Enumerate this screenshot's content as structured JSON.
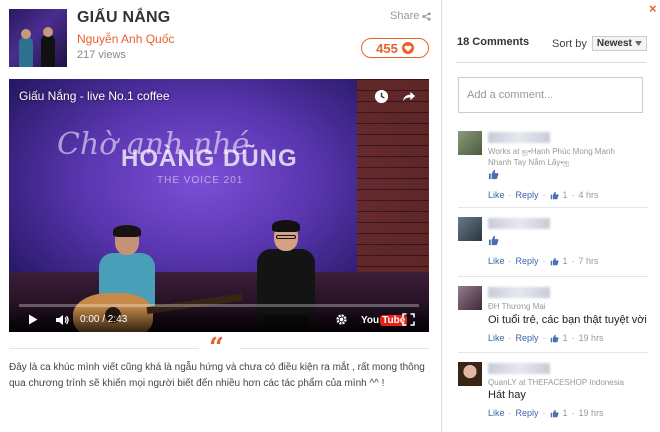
{
  "header": {
    "song_title": "GIẤU NẮNG",
    "artist": "Nguyễn Anh Quốc",
    "views": "217 views",
    "share_label": "Share",
    "like_count": "455"
  },
  "video": {
    "title": "Giấu Nắng - live No.1 coffee",
    "stage_line1": "Chờ anh nhé",
    "stage_line2": "HOÀNG DŨNG",
    "stage_line3": "THE VOICE 201",
    "time": "0:00 / 2:43",
    "brand": "You",
    "brand_tube": "Tube",
    "progress_fraction": 0.0
  },
  "quote_glyph": "“",
  "description": "Đây là ca khúc mình viết cũng khá là ngẫu hứng và chưa có điều kiện ra mắt , rất mong thông qua chương trình sẽ khiến mọi người biết đến nhiều hơn các tác phẩm của mình ^^ !",
  "comments_panel": {
    "close_label": "×",
    "count": "18 Comments",
    "sort_label": "Sort by",
    "sort_value": "Newest",
    "input_placeholder": "Add a comment...",
    "comments": [
      {
        "work": "Works at ஐ•Hạnh Phúc Mong Manh Nhanh Tay Nắm Lấy•ஐ",
        "text": "",
        "like": "Like",
        "reply": "Reply",
        "likes": "1",
        "time": "4 hrs",
        "avatar_color": "#6a7a5a"
      },
      {
        "work": "",
        "text": "",
        "like": "Like",
        "reply": "Reply",
        "likes": "1",
        "time": "7 hrs",
        "avatar_color": "#4a5a66"
      },
      {
        "work": "ĐH Thương Mại",
        "text": "Oi tuổi trẻ, các bạn thật tuyệt vời",
        "like": "Like",
        "reply": "Reply",
        "likes": "1",
        "time": "19 hrs",
        "avatar_color": "#7a5a6a"
      },
      {
        "work": "QuanLY at THEFACESHOP Indonesia",
        "text": "Hát hay",
        "like": "Like",
        "reply": "Reply",
        "likes": "1",
        "time": "19 hrs",
        "avatar_color": "#c9a28a"
      }
    ]
  },
  "colors": {
    "accent": "#e8602c",
    "link": "#3b67a8"
  }
}
